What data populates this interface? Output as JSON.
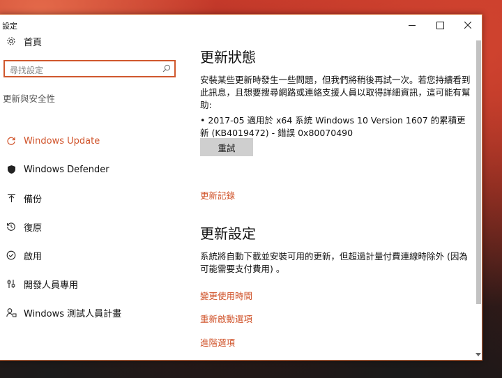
{
  "window": {
    "title": "設定",
    "controls": {
      "minimize": "—",
      "maximize": "□",
      "close": "✕"
    }
  },
  "sidebar": {
    "home": {
      "label": "首頁",
      "icon": "gear-icon"
    },
    "search": {
      "placeholder": "尋找設定",
      "icon": "search-icon"
    },
    "section": "更新與安全性",
    "items": [
      {
        "label": "Windows Update",
        "icon": "refresh-icon",
        "active": true
      },
      {
        "label": "Windows Defender",
        "icon": "shield-icon"
      },
      {
        "label": "備份",
        "icon": "upload-arrow-icon"
      },
      {
        "label": "復原",
        "icon": "history-icon"
      },
      {
        "label": "啟用",
        "icon": "check-circle-icon"
      },
      {
        "label": "開發人員專用",
        "icon": "developer-sliders-icon"
      },
      {
        "label": "Windows 測試人員計畫",
        "icon": "insider-person-icon"
      }
    ]
  },
  "main": {
    "status_title": "更新狀態",
    "status_message": "安裝某些更新時發生一些問題，但我們將稍後再試一次。若您持續看到此訊息，且想要搜尋網路或連絡支援人員以取得詳細資訊，這可能有幫助:",
    "failed_update": "• 2017-05 適用於 x64 系統 Windows 10 Version 1607 的累積更新 (KB4019472) - 錯誤 0x80070490",
    "retry_button": "重試",
    "history_link": "更新記錄",
    "settings_title": "更新設定",
    "settings_message": "系統將自動下載並安裝可用的更新，但超過計量付費連線時除外 (因為可能需要支付費用) 。",
    "links": [
      "變更使用時間",
      "重新啟動選項",
      "進階選項"
    ]
  },
  "colors": {
    "accent": "#d0532a",
    "button": "#cfcfcf"
  }
}
